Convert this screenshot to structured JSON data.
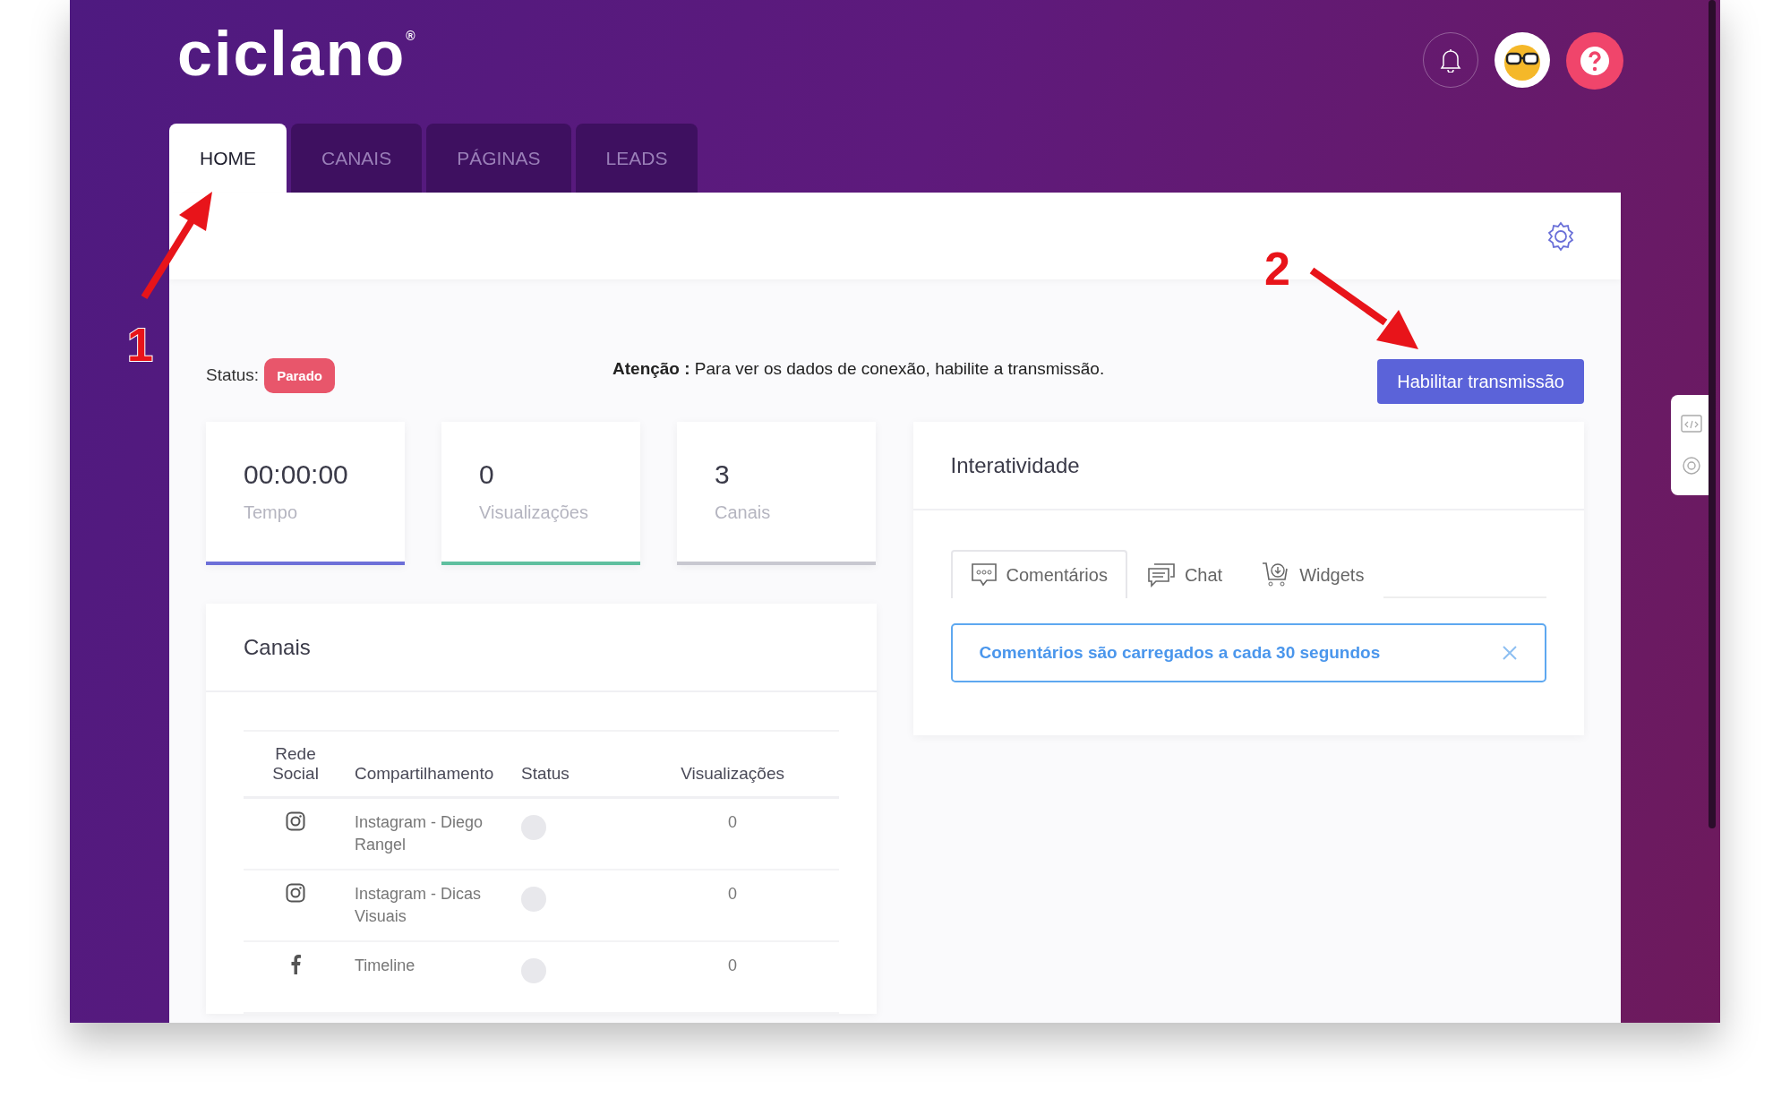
{
  "header": {
    "logo": "ciclano",
    "logo_mark": "®"
  },
  "tabs": [
    {
      "label": "HOME",
      "selected": true
    },
    {
      "label": "CANAIS",
      "selected": false
    },
    {
      "label": "PÁGINAS",
      "selected": false
    },
    {
      "label": "LEADS",
      "selected": false
    }
  ],
  "status": {
    "label": "Status:",
    "badge": "Parado"
  },
  "notice": "**Atenção :** Para ver os dados de conexão, habilite a transmissão.",
  "action_button": "Habilitar transmissão",
  "stats": [
    {
      "value": "00:00:00",
      "label": "Tempo",
      "color": "#6c6fd8"
    },
    {
      "value": "0",
      "label": "Visualizações",
      "color": "#5fbf9f"
    },
    {
      "value": "3",
      "label": "Canais",
      "color": "#c8c8d0"
    }
  ],
  "channels": {
    "title": "Canais",
    "columns": [
      "Rede Social",
      "Compartilhamento",
      "Status",
      "Visualizações"
    ],
    "rows": [
      {
        "kind": "instagram",
        "name": "Instagram - Diego Rangel",
        "active": false,
        "views": "0"
      },
      {
        "kind": "instagram",
        "name": "Instagram - Dicas Visuais",
        "active": false,
        "views": "0"
      },
      {
        "kind": "facebook",
        "name": "Timeline",
        "active": false,
        "views": "0"
      }
    ]
  },
  "interactivity": {
    "title": "Interatividade",
    "tabs": [
      {
        "label": "Comentários",
        "selected": true
      },
      {
        "label": "Chat",
        "selected": false
      },
      {
        "label": "Widgets",
        "selected": false
      }
    ],
    "alert": "Comentários são carregados a cada 30 segundos"
  },
  "annotations": [
    {
      "label": "1"
    },
    {
      "label": "2"
    }
  ]
}
